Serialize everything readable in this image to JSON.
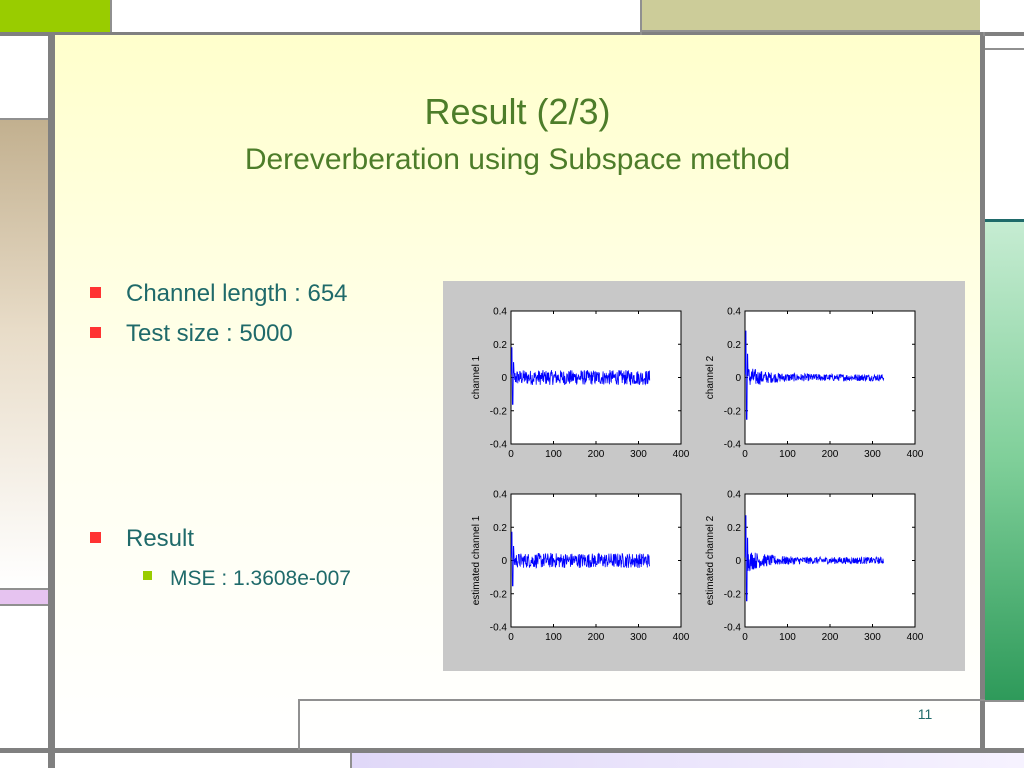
{
  "slide": {
    "title": "Result (2/3)",
    "subtitle": "Dereverberation using Subspace method",
    "bullets": [
      {
        "text": "Channel length : 654"
      },
      {
        "text": "Test size : 5000"
      },
      {
        "text": "Result"
      }
    ],
    "sub_bullets": [
      {
        "text": "MSE : 1.3608e-007"
      }
    ],
    "page_number": "11"
  },
  "colors": {
    "title": "#4d7d2a",
    "bullet_text": "#1f6a6a",
    "bullet_marker": "#ff3333",
    "sub_bullet_marker": "#99cc00",
    "signal": "#0000ff"
  },
  "chart_data": [
    {
      "type": "line",
      "ylabel": "channel 1",
      "xlim": [
        0,
        400
      ],
      "ylim": [
        -0.4,
        0.4
      ],
      "xticks": [
        "0",
        "100",
        "200",
        "300",
        "400"
      ],
      "yticks": [
        "0.4",
        "0.2",
        "0",
        "-0.2",
        "-0.4"
      ],
      "x_end": 327,
      "spike": 0.18,
      "noise": 0.045,
      "decay": 0
    },
    {
      "type": "line",
      "ylabel": "channel 2",
      "xlim": [
        0,
        400
      ],
      "ylim": [
        -0.4,
        0.4
      ],
      "xticks": [
        "0",
        "100",
        "200",
        "300",
        "400"
      ],
      "yticks": [
        "0.4",
        "0.2",
        "0",
        "-0.2",
        "-0.4"
      ],
      "x_end": 327,
      "spike": 0.28,
      "noise": 0.035,
      "decay": 1
    },
    {
      "type": "line",
      "ylabel": "estimated channel 1",
      "xlim": [
        0,
        400
      ],
      "ylim": [
        -0.4,
        0.4
      ],
      "xticks": [
        "0",
        "100",
        "200",
        "300",
        "400"
      ],
      "yticks": [
        "0.4",
        "0.2",
        "0",
        "-0.2",
        "-0.4"
      ],
      "x_end": 327,
      "spike": 0.17,
      "noise": 0.045,
      "decay": 0
    },
    {
      "type": "line",
      "ylabel": "estimated channel 2",
      "xlim": [
        0,
        400
      ],
      "ylim": [
        -0.4,
        0.4
      ],
      "xticks": [
        "0",
        "100",
        "200",
        "300",
        "400"
      ],
      "yticks": [
        "0.4",
        "0.2",
        "0",
        "-0.2",
        "-0.4"
      ],
      "x_end": 327,
      "spike": 0.27,
      "noise": 0.035,
      "decay": 1
    }
  ]
}
